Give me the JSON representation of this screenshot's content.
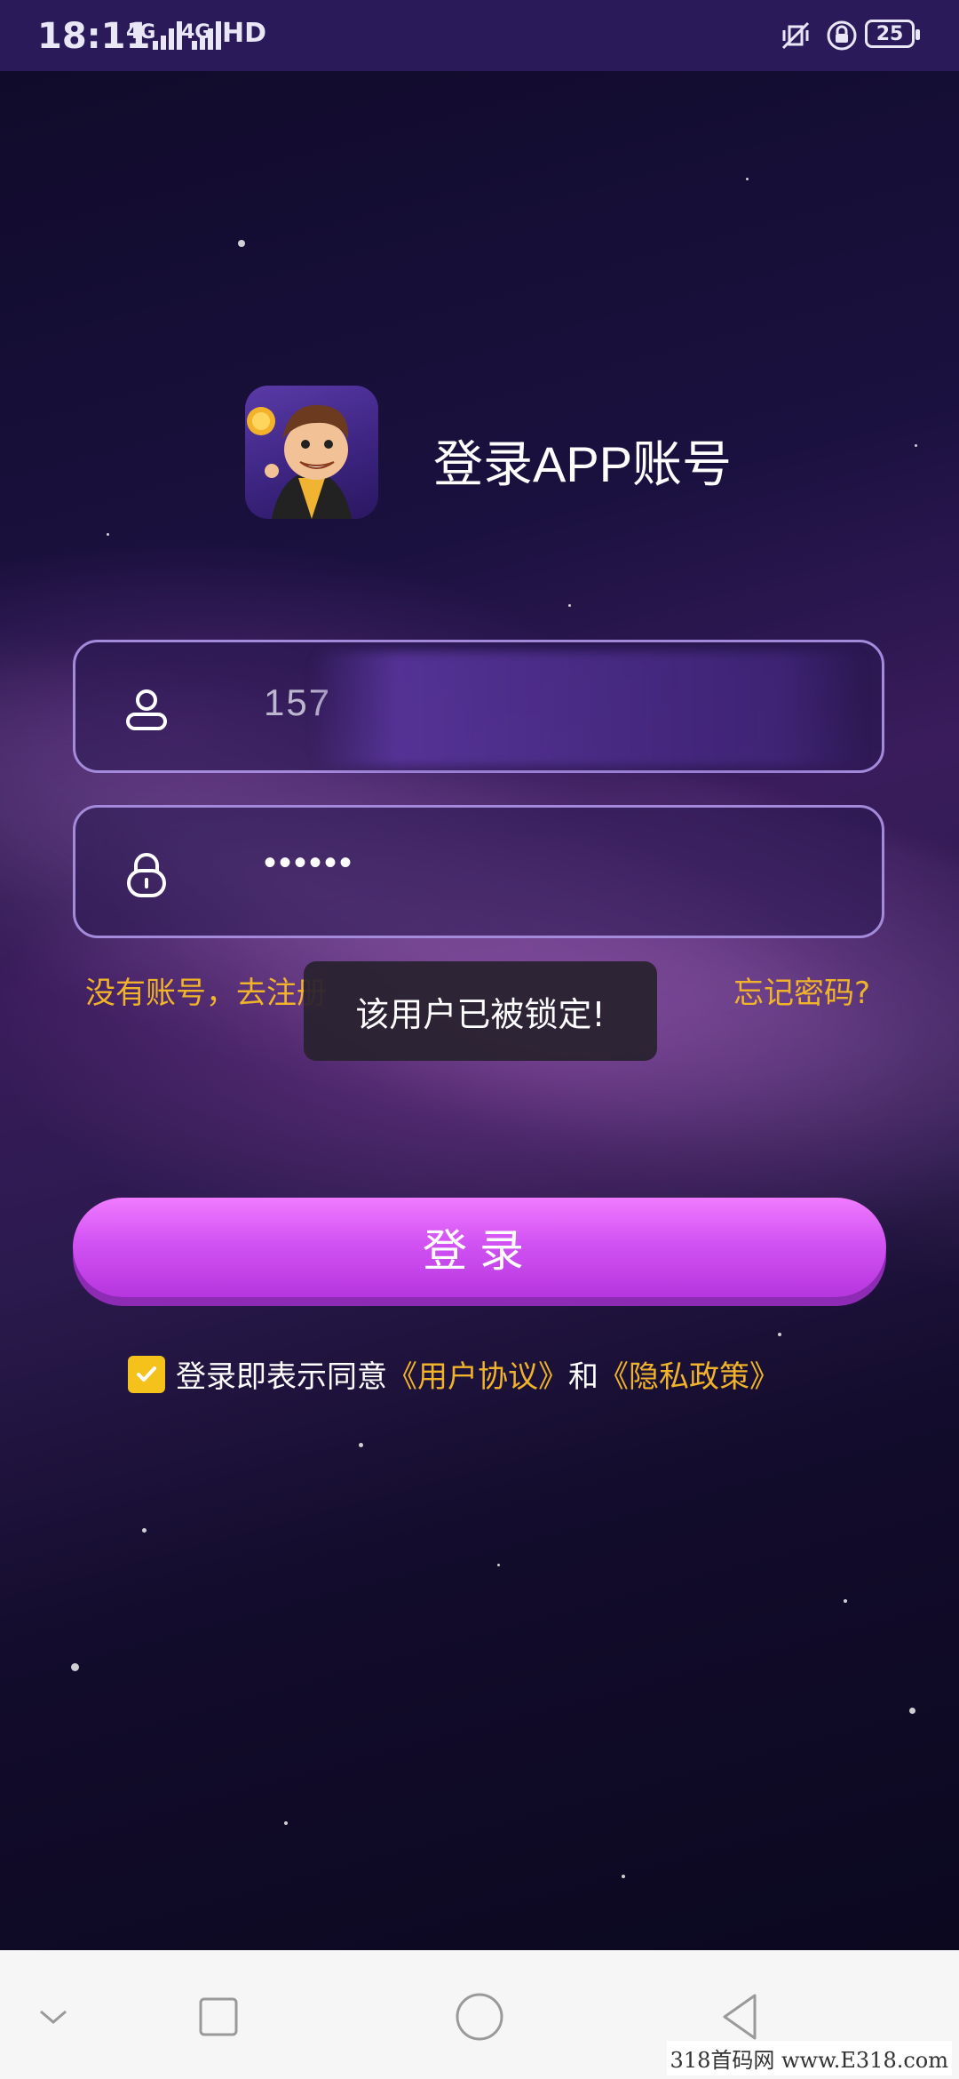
{
  "status_bar": {
    "time": "18:11",
    "network_1": "4G",
    "network_2": "4G",
    "hd": "HD",
    "battery": "25"
  },
  "header": {
    "title": "登录APP账号"
  },
  "form": {
    "username_value": "157",
    "password_value": "••••••"
  },
  "links": {
    "register": "没有账号，去注册",
    "forgot": "忘记密码?"
  },
  "toast": {
    "message": "该用户已被锁定!"
  },
  "login_button": {
    "label": "登录"
  },
  "agreement": {
    "prefix": "登录即表示同意",
    "user_agreement": "《用户协议》",
    "and": "和",
    "privacy_policy": "《隐私政策》",
    "checked": true
  },
  "watermark": "318首码网 www.E318.com",
  "colors": {
    "accent_gold": "#f0b32a",
    "button_pink": "#d253f3",
    "field_border": "#a48adb",
    "status_bar": "#2a1a5a"
  }
}
